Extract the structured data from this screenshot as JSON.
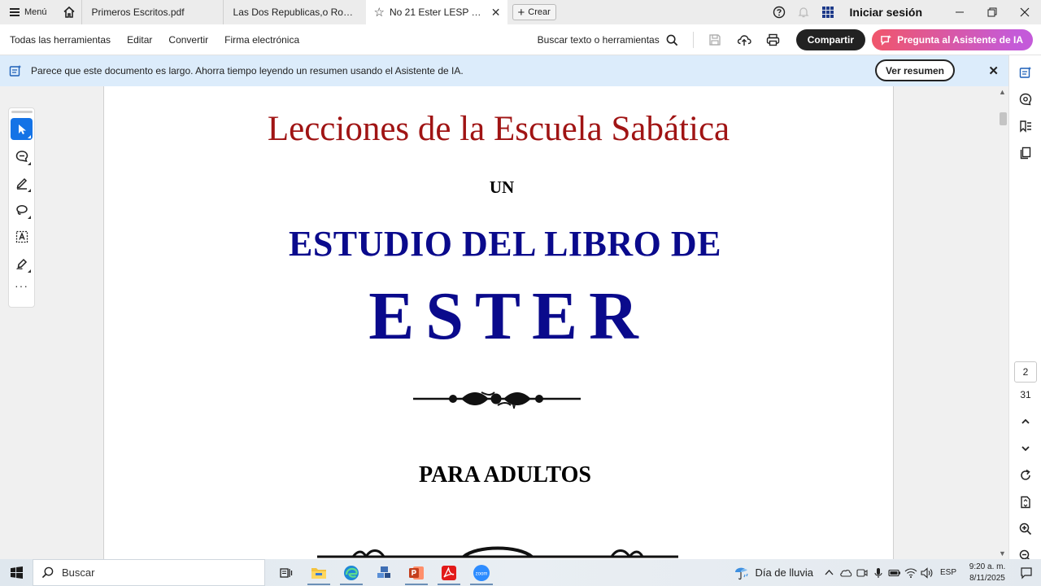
{
  "tabbar": {
    "menu_label": "Menú",
    "tabs": [
      {
        "label": "Primeros Escritos.pdf"
      },
      {
        "label": "Las Dos Republicas,o Roma y Estados Unidos.pdf"
      },
      {
        "label": "No 21 Ester LESP Re...",
        "active": true
      }
    ],
    "create_label": "Crear",
    "signin_label": "Iniciar sesión"
  },
  "toolbar": {
    "menus": [
      "Todas las herramientas",
      "Editar",
      "Convertir",
      "Firma electrónica"
    ],
    "search_label": "Buscar texto o herramientas",
    "share_label": "Compartir",
    "ai_label": "Pregunta al Asistente de IA"
  },
  "banner": {
    "text": "Parece que este documento es largo. Ahorra tiempo leyendo un resumen usando el Asistente de IA.",
    "button_label": "Ver resumen",
    "close_glyph": "✕"
  },
  "document": {
    "title": "Lecciones de la Escuela Sabática",
    "un": "UN",
    "estudio": "ESTUDIO DEL LIBRO DE",
    "ester": "ESTER",
    "adultos": "PARA ADULTOS",
    "title_color": "#a01414",
    "heading_color": "#0a0a8c"
  },
  "navigation": {
    "current_page": "2",
    "total_pages": "31"
  },
  "taskbar": {
    "search_placeholder": "Buscar",
    "weather_label": "Día de lluvia",
    "language": "ESP",
    "time": "9:20 a. m.",
    "date": "8/11/2025"
  },
  "colors": {
    "accent_blue": "#1473e6",
    "info_banner": "#dcecfb",
    "ai_gradient_start": "#f0566b",
    "ai_gradient_end": "#c45ad9"
  }
}
